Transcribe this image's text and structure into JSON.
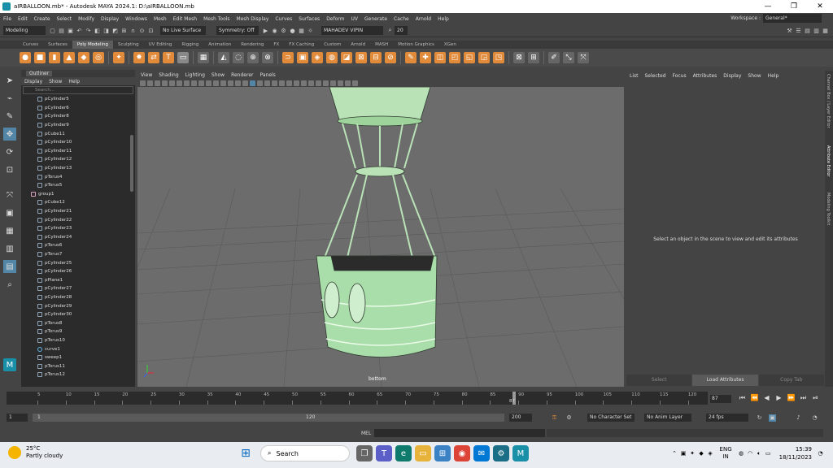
{
  "window": {
    "title": "aIRBALLOON.mb* - Autodesk MAYA 2024.1: D:\\aIRBALLOON.mb"
  },
  "menubar": [
    "File",
    "Edit",
    "Create",
    "Select",
    "Modify",
    "Display",
    "Windows",
    "Mesh",
    "Edit Mesh",
    "Mesh Tools",
    "Mesh Display",
    "Curves",
    "Surfaces",
    "Deform",
    "UV",
    "Generate",
    "Cache",
    "Arnold",
    "Help"
  ],
  "workspace": {
    "label": "Workspace :",
    "value": "General*"
  },
  "statusline": {
    "mode": "Modeling",
    "live_surface": "No Live Surface",
    "symmetry": "Symmetry: Off",
    "user": "MAHADEV VIPIN",
    "count": "20"
  },
  "shelf_tabs": [
    "Curves",
    "Surfaces",
    "Poly Modeling",
    "Sculpting",
    "UV Editing",
    "Rigging",
    "Animation",
    "Rendering",
    "FX",
    "FX Caching",
    "Custom",
    "Arnold",
    "MASH",
    "Motion Graphics",
    "XGen"
  ],
  "shelf_active": "Poly Modeling",
  "outliner": {
    "tab": "Outliner",
    "menu": [
      "Display",
      "Show",
      "Help"
    ],
    "search_placeholder": "Search...",
    "items": [
      "pCylinder5",
      "pCylinder6",
      "pCylinder8",
      "pCylinder9",
      "pCube11",
      "pCylinder10",
      "pCylinder11",
      "pCylinder12",
      "pCylinder13",
      "pTorus4",
      "pTorus5",
      "group1",
      "pCube12",
      "pCylinder21",
      "pCylinder22",
      "pCylinder23",
      "pCylinder24",
      "pTorus6",
      "pTorus7",
      "pCylinder25",
      "pCylinder26",
      "pPlane1",
      "pCylinder27",
      "pCylinder28",
      "pCylinder29",
      "pCylinder30",
      "pTorus8",
      "pTorus9",
      "pTorus10",
      "curve1",
      "sweep1",
      "pTorus11",
      "pTorus12"
    ]
  },
  "viewport": {
    "menu": [
      "View",
      "Shading",
      "Lighting",
      "Show",
      "Renderer",
      "Panels"
    ],
    "camera_label": "bottom"
  },
  "attribute_editor": {
    "menu": [
      "List",
      "Selected",
      "Focus",
      "Attributes",
      "Display",
      "Show",
      "Help"
    ],
    "message": "Select an object in the scene to view and edit its attributes",
    "buttons": [
      "Select",
      "Load Attributes",
      "Copy Tab"
    ]
  },
  "side_tabs": [
    "Channel Box / Layer Editor",
    "Attribute Editor",
    "Modeling Toolkit"
  ],
  "timeline": {
    "ticks": [
      "5",
      "10",
      "15",
      "20",
      "25",
      "30",
      "35",
      "40",
      "45",
      "50",
      "55",
      "60",
      "65",
      "70",
      "75",
      "80",
      "85",
      "90",
      "95",
      "100",
      "105",
      "110",
      "115",
      "120"
    ],
    "current_frame": "87",
    "current_field": "87"
  },
  "range": {
    "start": "1",
    "inner_start": "1",
    "inner_end": "120",
    "end": "200",
    "character_set": "No Character Set",
    "anim_layer": "No Anim Layer",
    "fps": "24 fps"
  },
  "cmdline": {
    "label": "MEL"
  },
  "taskbar": {
    "temperature": "25°C",
    "weather": "Partly cloudy",
    "search": "Search",
    "lang_top": "ENG",
    "lang_bottom": "IN",
    "time": "15:39",
    "date": "18/11/2023"
  }
}
